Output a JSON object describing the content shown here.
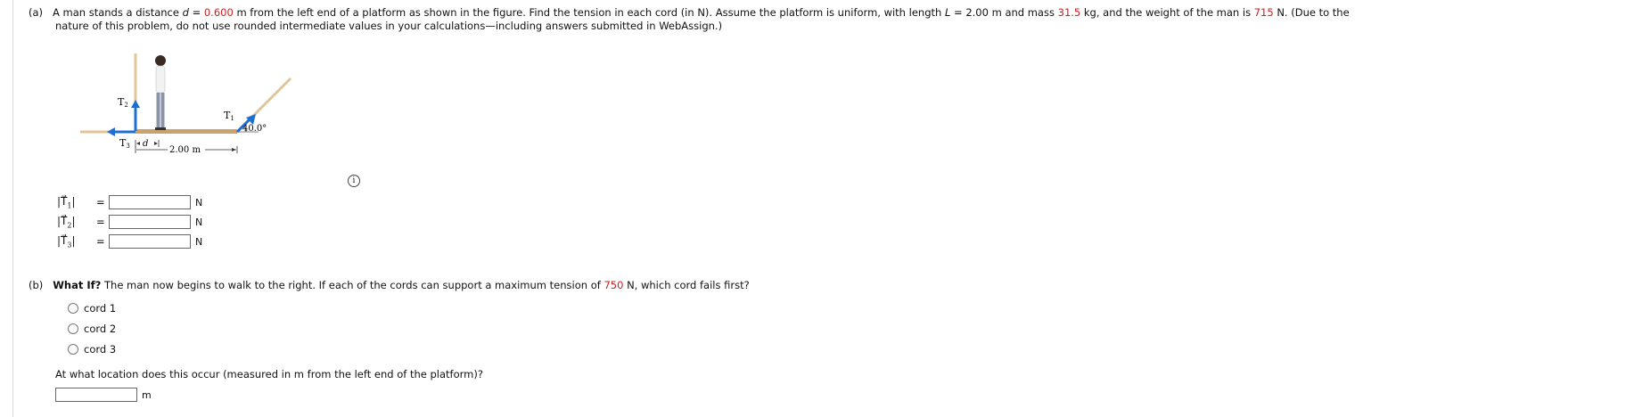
{
  "part_a": {
    "label": "(a)",
    "text_1": "A man stands a distance",
    "d_symbol": "d",
    "equals": "=",
    "d_value": "0.600",
    "text_2": "m from the left end of a platform as shown in the figure. Find the tension in each cord (in N). Assume the platform is uniform, with length",
    "L_symbol": "L",
    "L_text": "= 2.00 m and mass",
    "mass_value": "31.5",
    "text_3": "kg, and the weight of the man is",
    "weight_value": "715",
    "text_4": "N. (Due to the",
    "text_line2": "nature of this problem, do not use rounded intermediate values in your calculations—including answers submitted in WebAssign.)",
    "figure": {
      "t1_label": "T",
      "t1_sub": "1",
      "t2_label": "T",
      "t2_sub": "2",
      "t3_label": "T",
      "t3_sub": "3",
      "d_label": "d",
      "length_label": "2.00 m",
      "angle_label": "40.0°"
    },
    "info_icon_glyph": "i",
    "answers": [
      {
        "sym": "T",
        "sub": "1",
        "eq": "=",
        "value": "",
        "unit": "N"
      },
      {
        "sym": "T",
        "sub": "2",
        "eq": "=",
        "value": "",
        "unit": "N"
      },
      {
        "sym": "T",
        "sub": "3",
        "eq": "=",
        "value": "",
        "unit": "N"
      }
    ]
  },
  "part_b": {
    "label": "(b)",
    "what_if": "What If?",
    "text_1": "The man now begins to walk to the right. If each of the cords can support a maximum tension of",
    "max_tension": "750",
    "text_2": "N, which cord fails first?",
    "options": [
      "cord 1",
      "cord 2",
      "cord 3"
    ],
    "location_question": "At what location does this occur (measured in m from the left end of the platform)?",
    "location_value": "",
    "location_unit": "m"
  },
  "colors": {
    "red_value": "#cc1f1f",
    "arrow_blue": "#1f6fd1",
    "platform_tan": "#c9a36b",
    "cord_tan": "#e0c49a"
  }
}
